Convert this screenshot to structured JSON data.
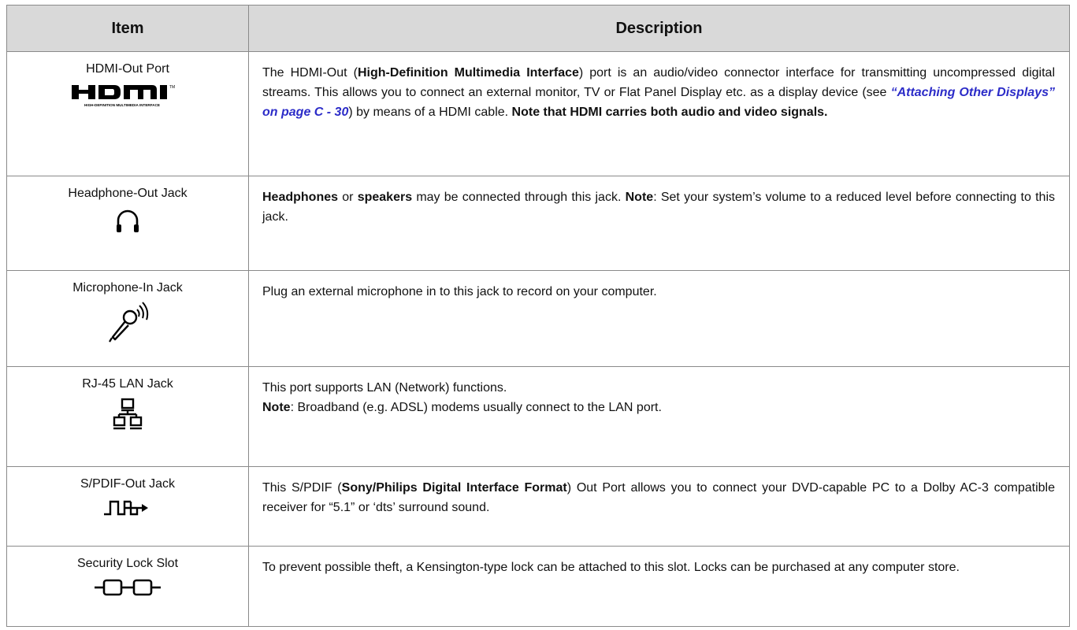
{
  "header": {
    "item": "Item",
    "description": "Description"
  },
  "rows": [
    {
      "name": "HDMI-Out Port",
      "icon": "hdmi-logo-icon",
      "hdmi_sub": "HIGH-DEFINITION MULTIMEDIA INTERFACE",
      "desc": {
        "t1": "The HDMI-Out (",
        "b1": "High-Definition Multimedia Interface",
        "t2": ") port is an audio/video connector interface for transmitting uncompressed digital streams. This allows you to connect an external monitor, TV or Flat Panel Display etc. as a display device (see ",
        "link": "“Attaching Other Displays” on page C - 30",
        "t3": ") by means of a HDMI cable. ",
        "b2": "Note that HDMI carries both audio and video signals."
      }
    },
    {
      "name": "Headphone-Out Jack",
      "icon": "headphone-icon",
      "desc": {
        "b1": "Headphones",
        "t1": " or ",
        "b2": "speakers",
        "t2": " may be connected through this jack. ",
        "b3": "Note",
        "t3": ": Set your system’s volume to a reduced level before connecting to this jack."
      }
    },
    {
      "name": "Microphone-In Jack",
      "icon": "microphone-icon",
      "desc": {
        "t1": "Plug an external microphone in to this jack to record on your computer."
      }
    },
    {
      "name": "RJ-45 LAN Jack",
      "icon": "network-icon",
      "desc": {
        "t1": "This port supports LAN (Network) functions.",
        "b1": "Note",
        "t2": ": Broadband (e.g. ADSL) modems usually connect to the LAN port."
      }
    },
    {
      "name": "S/PDIF-Out Jack",
      "icon": "spdif-icon",
      "desc": {
        "t1": "This S/PDIF (",
        "b1": "Sony/Philips Digital Interface Format",
        "t2": ") Out Port allows you to connect your DVD-capable PC to a Dolby AC-3 compatible receiver for “5.1” or ‘dts’ surround sound."
      }
    },
    {
      "name": "Security Lock Slot",
      "icon": "security-lock-icon",
      "desc": {
        "t1": "To prevent possible theft, a Kensington-type lock can be attached to this slot. Locks can be purchased at any computer store."
      }
    }
  ]
}
